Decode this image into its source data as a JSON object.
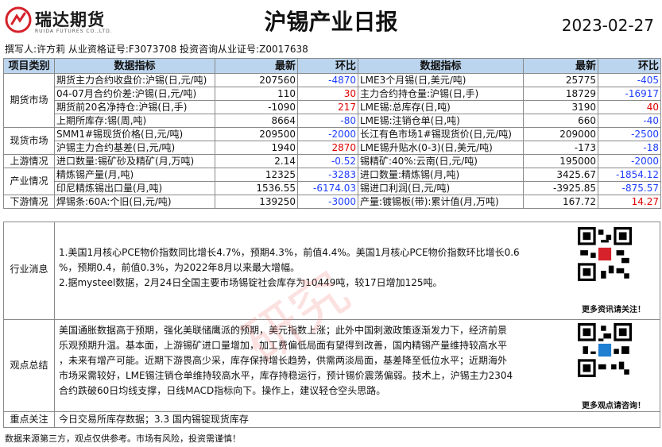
{
  "header": {
    "logo_cn": "瑞达期货",
    "logo_en": "RUIDA FUTURES CO.,LTD.",
    "title": "沪锡产业日报",
    "date": "2023-02-27",
    "authors": "撰写人:许方莉 从业资格证号:F3073708 投资咨询从业证号:Z0017638"
  },
  "table": {
    "headers": [
      "项目类别",
      "数据指标",
      "最新",
      "环比",
      "数据指标",
      "最新",
      "环比"
    ],
    "groups": [
      {
        "category": "期货市场",
        "rows": [
          {
            "l_name": "期货主力合约收盘价:沪锡(日,元/吨)",
            "l_val": "207560",
            "l_chg": "-4870",
            "r_name": "LME3个月锡(日,美元/吨)",
            "r_val": "25775",
            "r_chg": "-405"
          },
          {
            "l_name": "04-07月合约价差:沪锡(日,元/吨)",
            "l_val": "110",
            "l_chg": "30",
            "r_name": "主力合约持仓量:沪锡(日,手)",
            "r_val": "18729",
            "r_chg": "-16917"
          },
          {
            "l_name": "期货前20名净持仓:沪锡(日,手)",
            "l_val": "-1090",
            "l_chg": "217",
            "r_name": "LME锡:总库存(日,吨)",
            "r_val": "3190",
            "r_chg": "40"
          },
          {
            "l_name": "上期所库存:锡(周,吨)",
            "l_val": "8664",
            "l_chg": "-80",
            "r_name": "LME锡:注销仓单(日,吨)",
            "r_val": "660",
            "r_chg": "-40"
          }
        ]
      },
      {
        "category": "现货市场",
        "rows": [
          {
            "l_name": "SMM1#锡现货价格(日,元/吨)",
            "l_val": "209500",
            "l_chg": "-2000",
            "r_name": "长江有色市场1#锡现货价(日,元/吨)",
            "r_val": "209000",
            "r_chg": "-2500"
          },
          {
            "l_name": "沪锡主力合约基差(日,元/吨)",
            "l_val": "1940",
            "l_chg": "2870",
            "r_name": "LME锡升贴水(0-3)(日,美元/吨)",
            "r_val": "-173",
            "r_chg": "-18"
          }
        ]
      },
      {
        "category": "上游情况",
        "rows": [
          {
            "l_name": "进口数量:锡矿砂及精矿(月,万吨)",
            "l_val": "2.14",
            "l_chg": "-0.52",
            "r_name": "锡精矿:40%:云南(日,元/吨)",
            "r_val": "195000",
            "r_chg": "-2000"
          }
        ]
      },
      {
        "category": "产业情况",
        "rows": [
          {
            "l_name": "精炼锡产量(月,吨)",
            "l_val": "12325",
            "l_chg": "-3283",
            "r_name": "进口数量:精炼锡(月,吨)",
            "r_val": "3425.67",
            "r_chg": "-1854.12"
          },
          {
            "l_name": "印尼精炼锡出口量(月,吨)",
            "l_val": "1536.55",
            "l_chg": "-6174.03",
            "r_name": "锡进口利润(日,元/吨)",
            "r_val": "-3925.85",
            "r_chg": "-875.57"
          }
        ]
      },
      {
        "category": "下游情况",
        "rows": [
          {
            "l_name": "焊锡条:60A:个旧(日,元/吨)",
            "l_val": "139250",
            "l_chg": "-3000",
            "r_name": "产量:镀锡板(带):累计值(月,万吨)",
            "r_val": "167.72",
            "r_chg": "14.27"
          }
        ]
      }
    ]
  },
  "news": {
    "label": "行业消息",
    "lines": [
      "1.美国1月核心PCE物价指数同比增长4.7%，预期4.3%，前值4.4%。美国1月核心PCE物价指数环比增长0.6",
      "%，预期0.4，前值0.3%，为2022年8月以来最大增幅。",
      "2.据mysteel数据，2月24日全国主要市场锡锭社会库存为10449吨，较17日增加125吨。"
    ],
    "qr_caption": "更多资讯请关注！"
  },
  "view": {
    "label": "观点总结",
    "lines": [
      "美国通胀数据高于预期，强化美联储鹰派的预期，美元指数上涨；此外中国刺激政策逐渐发力下，经济前景",
      "乐观预期升温。基本面，上游锡矿进口量增加，加工费偏低局面有望得到改善，国内精锡产量维持较高水平",
      "，未来有增产可能。近期下游畏高少采，库存保持增长趋势，供需两淡局面，基差降至低位水平；近期海外",
      "市场采需较好，LME锡注销仓单维持较高水平，库存持稳运行，预计锡价震荡偏弱。技术上，沪锡主力2304",
      "合约跌破60日均线支撑，日线MACD指标向下。操作上，建议轻仓空头思路。"
    ],
    "qr_caption": "更多观点请咨询！"
  },
  "focus": {
    "label": "重点关注",
    "text": "今日交易所库存数据；3.3 国内锡锭现货库存"
  },
  "footer": "数据来源第三方，观点仅供参考。市场有风险，投资需谨慎！",
  "watermark": "研究",
  "colors": {
    "header_bg": "#bcd5ee",
    "negative": "#1f3fff",
    "positive": "#e00000",
    "logo_red": "#d6222a"
  }
}
